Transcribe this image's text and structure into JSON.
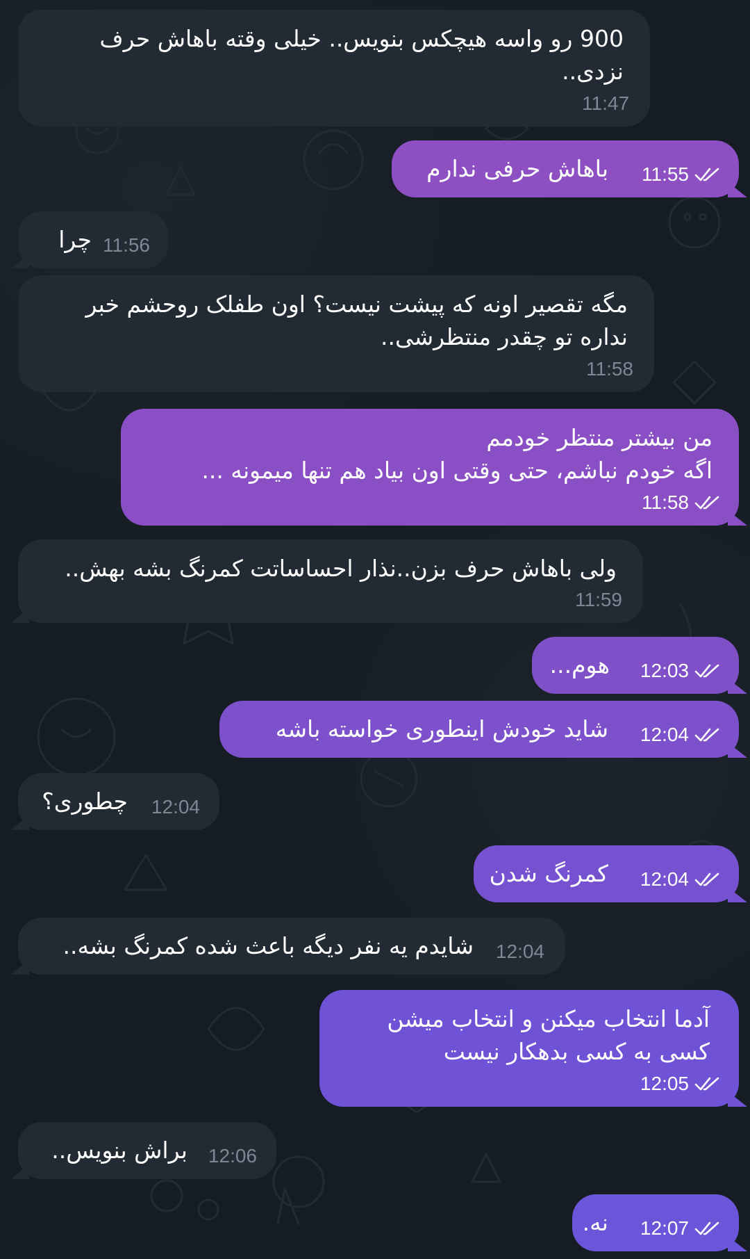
{
  "conversation": {
    "messages": [
      {
        "direction": "incoming",
        "lines": [
          "900 رو واسه هیچکس بنویس.. خیلی وقته باهاش حرف",
          "نزدی.."
        ],
        "time": "11:47"
      },
      {
        "direction": "outgoing",
        "lines": [
          "باهاش حرفی ندارم"
        ],
        "time": "11:55",
        "status": "read",
        "color": "#8e4fc2"
      },
      {
        "direction": "incoming",
        "lines": [
          "چرا"
        ],
        "time": "11:56"
      },
      {
        "direction": "incoming",
        "lines": [
          "مگه تقصیر اونه که پیشت نیست؟ اون طفلک روحشم خبر",
          "نداره تو چقدر منتظرشی.."
        ],
        "time": "11:58"
      },
      {
        "direction": "outgoing",
        "lines": [
          "من بیشتر منتظر خودمم",
          "اگه خودم نباشم، حتی وقتی اون بیاد هم تنها میمونه ..."
        ],
        "time": "11:58",
        "status": "read",
        "color": "#8a4fc4"
      },
      {
        "direction": "incoming",
        "lines": [
          "ولی باهاش حرف بزن..نذار احساساتت کمرنگ بشه بهش.."
        ],
        "time": "11:59"
      },
      {
        "direction": "outgoing",
        "lines": [
          "هوم..."
        ],
        "time": "12:03",
        "status": "read",
        "color": "#8050c9"
      },
      {
        "direction": "outgoing",
        "lines": [
          "شاید خودش اینطوری خواسته باشه"
        ],
        "time": "12:04",
        "status": "read",
        "color": "#7d51cb"
      },
      {
        "direction": "incoming",
        "lines": [
          "چطوری؟"
        ],
        "time": "12:04"
      },
      {
        "direction": "outgoing",
        "lines": [
          "کمرنگ شدن"
        ],
        "time": "12:04",
        "status": "read",
        "color": "#7652d0"
      },
      {
        "direction": "incoming",
        "lines": [
          "شایدم یه نفر دیگه باعث شده کمرنگ بشه.."
        ],
        "time": "12:04"
      },
      {
        "direction": "outgoing",
        "lines": [
          "آدما انتخاب میکنن و انتخاب میشن",
          "کسی به کسی بدهکار نیست"
        ],
        "time": "12:05",
        "status": "read",
        "color": "#6f52d6"
      },
      {
        "direction": "incoming",
        "lines": [
          "براش بنویس.."
        ],
        "time": "12:06"
      },
      {
        "direction": "outgoing",
        "lines": [
          "نه."
        ],
        "time": "12:07",
        "status": "read",
        "color": "#6b55d9"
      }
    ]
  },
  "theme": {
    "background": "#151c24",
    "incoming_bubble": "#222a33",
    "incoming_time": "#7d8894",
    "outgoing_text": "#ffffff",
    "status_icon": "double-check-icon"
  }
}
